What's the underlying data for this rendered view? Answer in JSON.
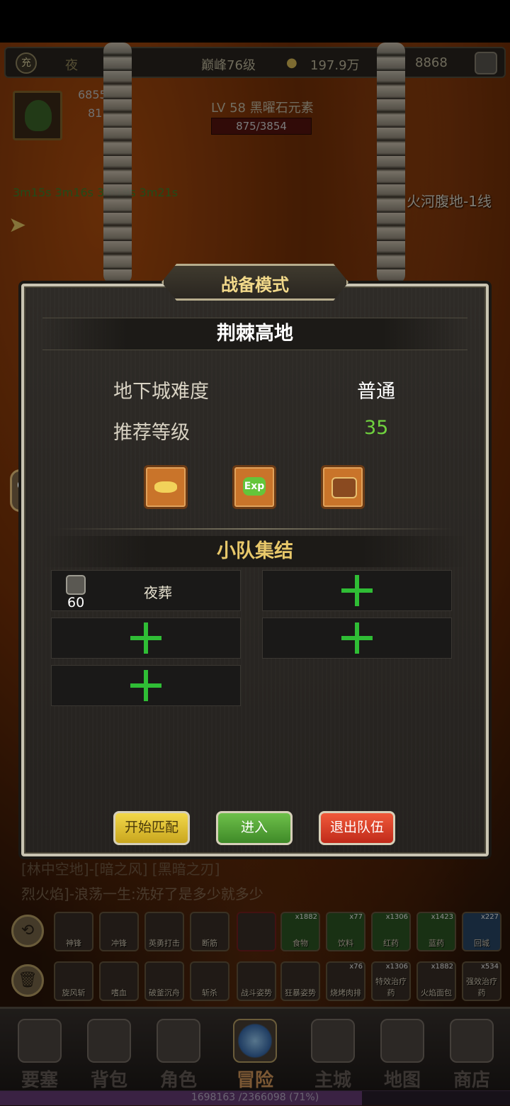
{
  "topbar": {
    "badge": "充",
    "player_name": "夜",
    "peak_level": "巅峰76级",
    "gold": "197.9万",
    "gems": "8868"
  },
  "player": {
    "hp": "6855",
    "mp": "81"
  },
  "enemy": {
    "name": "LV 58 黑曜石元素",
    "hp": "875/3854"
  },
  "zone": "火河腹地-1线",
  "timers": "3m15s 3m16s 3m19s 3m21s",
  "chat": {
    "label": "聊天"
  },
  "chatlog": {
    "line1": "[林中空地]-[暗之风] [黑暗之刃]",
    "line2": "烈火焰]-浪荡一生:洗好了是多少就多少"
  },
  "modal": {
    "title": "战备模式",
    "map_name": "荆棘高地",
    "difficulty_label": "地下城难度",
    "difficulty_value": "普通",
    "rec_level_label": "推荐等级",
    "rec_level_value": "35",
    "rewards": [
      "gold-coin-icon",
      "exp-icon",
      "treasure-chest-icon"
    ],
    "exp_text": "Exp",
    "squad_title": "小队集结",
    "member": {
      "level": "60",
      "name": "夜葬"
    },
    "buttons": {
      "match": "开始匹配",
      "enter": "进入",
      "leave": "退出队伍"
    }
  },
  "skills_row1": [
    "神锋",
    "冲锋",
    "英勇打击",
    "断筋"
  ],
  "skills_row2": [
    "旋风斩",
    "嗜血",
    "破釜沉舟",
    "斩杀",
    "战斗姿势",
    "狂暴姿势"
  ],
  "items_row1": [
    {
      "label": "食物",
      "count": "x1882"
    },
    {
      "label": "饮料",
      "count": "x77"
    },
    {
      "label": "红药",
      "count": "x1306"
    },
    {
      "label": "蓝药",
      "count": "x1423"
    },
    {
      "label": "回城",
      "count": "x227"
    }
  ],
  "items_row2": [
    {
      "label": "烧烤肉排",
      "count": "x76"
    },
    {
      "label": "特效治疗药",
      "count": "x1306"
    },
    {
      "label": "火焰面包",
      "count": "x1882"
    },
    {
      "label": "强效治疗药",
      "count": "x534"
    }
  ],
  "nav": [
    "要塞",
    "背包",
    "角色",
    "冒险",
    "主城",
    "地图",
    "商店"
  ],
  "xp": {
    "text": "1698163 /2366098 (71%)",
    "progress": 0.71
  },
  "colors": {
    "accent_gold": "#f2d98a",
    "plus_green": "#2fbd35",
    "level_green": "#6fd13e"
  }
}
